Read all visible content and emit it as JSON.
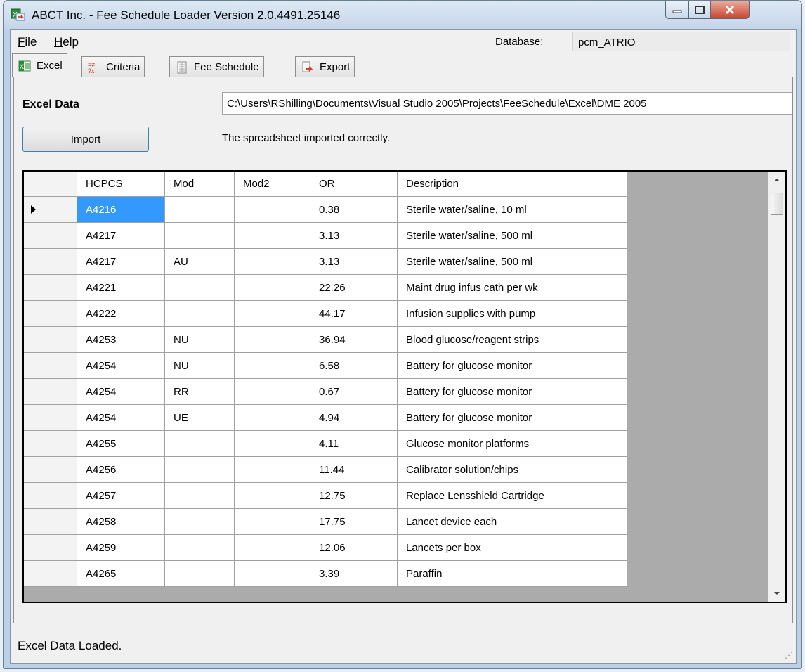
{
  "window": {
    "title": "ABCT Inc. - Fee Schedule Loader Version 2.0.4491.25146",
    "icon": "excel-import-icon"
  },
  "menu": {
    "file_prefix": "F",
    "file_rest": "ile",
    "help_prefix": "H",
    "help_rest": "elp"
  },
  "database": {
    "label": "Database:",
    "value": "pcm_ATRIO"
  },
  "tabs": [
    {
      "label": "Excel",
      "icon": "excel-icon"
    },
    {
      "label": "Criteria",
      "icon": "criteria-icon"
    },
    {
      "label": "Fee Schedule",
      "icon": "grid-icon"
    },
    {
      "label": "Export",
      "icon": "export-icon"
    }
  ],
  "excel": {
    "label": "Excel Data",
    "path": "C:\\Users\\RShilling\\Documents\\Visual Studio 2005\\Projects\\FeeSchedule\\Excel\\DME 2005",
    "import_label": "Import",
    "message": "The spreadsheet imported correctly."
  },
  "grid": {
    "columns": [
      "HCPCS",
      "Mod",
      "Mod2",
      "OR",
      "Description"
    ],
    "rows": [
      [
        "A4216",
        "",
        "",
        "0.38",
        "Sterile water/saline, 10 ml"
      ],
      [
        "A4217",
        "",
        "",
        "3.13",
        "Sterile water/saline, 500 ml"
      ],
      [
        "A4217",
        "AU",
        "",
        "3.13",
        "Sterile water/saline, 500 ml"
      ],
      [
        "A4221",
        "",
        "",
        "22.26",
        "Maint drug infus cath per wk"
      ],
      [
        "A4222",
        "",
        "",
        "44.17",
        "Infusion supplies with pump"
      ],
      [
        "A4253",
        "NU",
        "",
        "36.94",
        "Blood glucose/reagent strips"
      ],
      [
        "A4254",
        "NU",
        "",
        "6.58",
        "Battery for glucose monitor"
      ],
      [
        "A4254",
        "RR",
        "",
        "0.67",
        "Battery for glucose monitor"
      ],
      [
        "A4254",
        "UE",
        "",
        "4.94",
        "Battery for glucose monitor"
      ],
      [
        "A4255",
        "",
        "",
        "4.11",
        "Glucose monitor platforms"
      ],
      [
        "A4256",
        "",
        "",
        "11.44",
        "Calibrator solution/chips"
      ],
      [
        "A4257",
        "",
        "",
        "12.75",
        "Replace Lensshield Cartridge"
      ],
      [
        "A4258",
        "",
        "",
        "17.75",
        "Lancet device each"
      ],
      [
        "A4259",
        "",
        "",
        "12.06",
        "Lancets per box"
      ],
      [
        "A4265",
        "",
        "",
        "3.39",
        "Paraffin"
      ]
    ]
  },
  "status": {
    "text": "Excel Data Loaded."
  }
}
